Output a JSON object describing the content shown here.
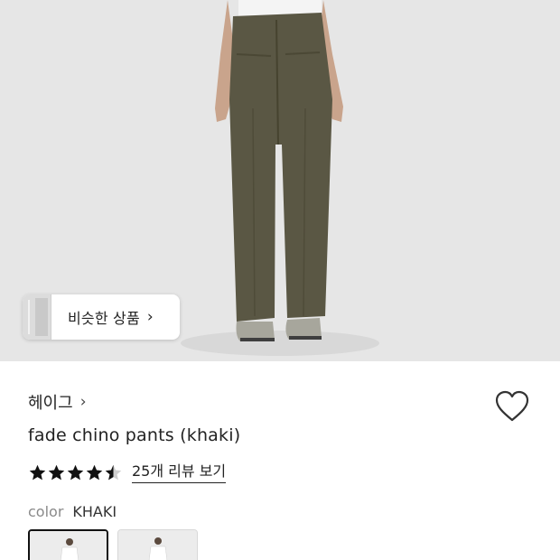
{
  "hero": {
    "image_alt": "model wearing fade chino pants in khaki",
    "background": "#e6e6e6"
  },
  "similar": {
    "label": "비슷한 상품",
    "chevron": "›"
  },
  "brand": {
    "name": "헤이그",
    "chevron": "›"
  },
  "wishlist": {
    "icon": "heart-outline-icon"
  },
  "product": {
    "title": "fade chino pants (khaki)"
  },
  "rating": {
    "value": 4.5,
    "max": 5,
    "review_link": "25개 리뷰 보기"
  },
  "color": {
    "key": "color",
    "value": "KHAKI"
  },
  "swatches": [
    {
      "name": "khaki",
      "selected": true
    },
    {
      "name": "alt",
      "selected": false
    }
  ],
  "colors": {
    "pants": "#5a5744",
    "star": "#111111",
    "text": "#222222",
    "muted": "#8a8a8a"
  }
}
